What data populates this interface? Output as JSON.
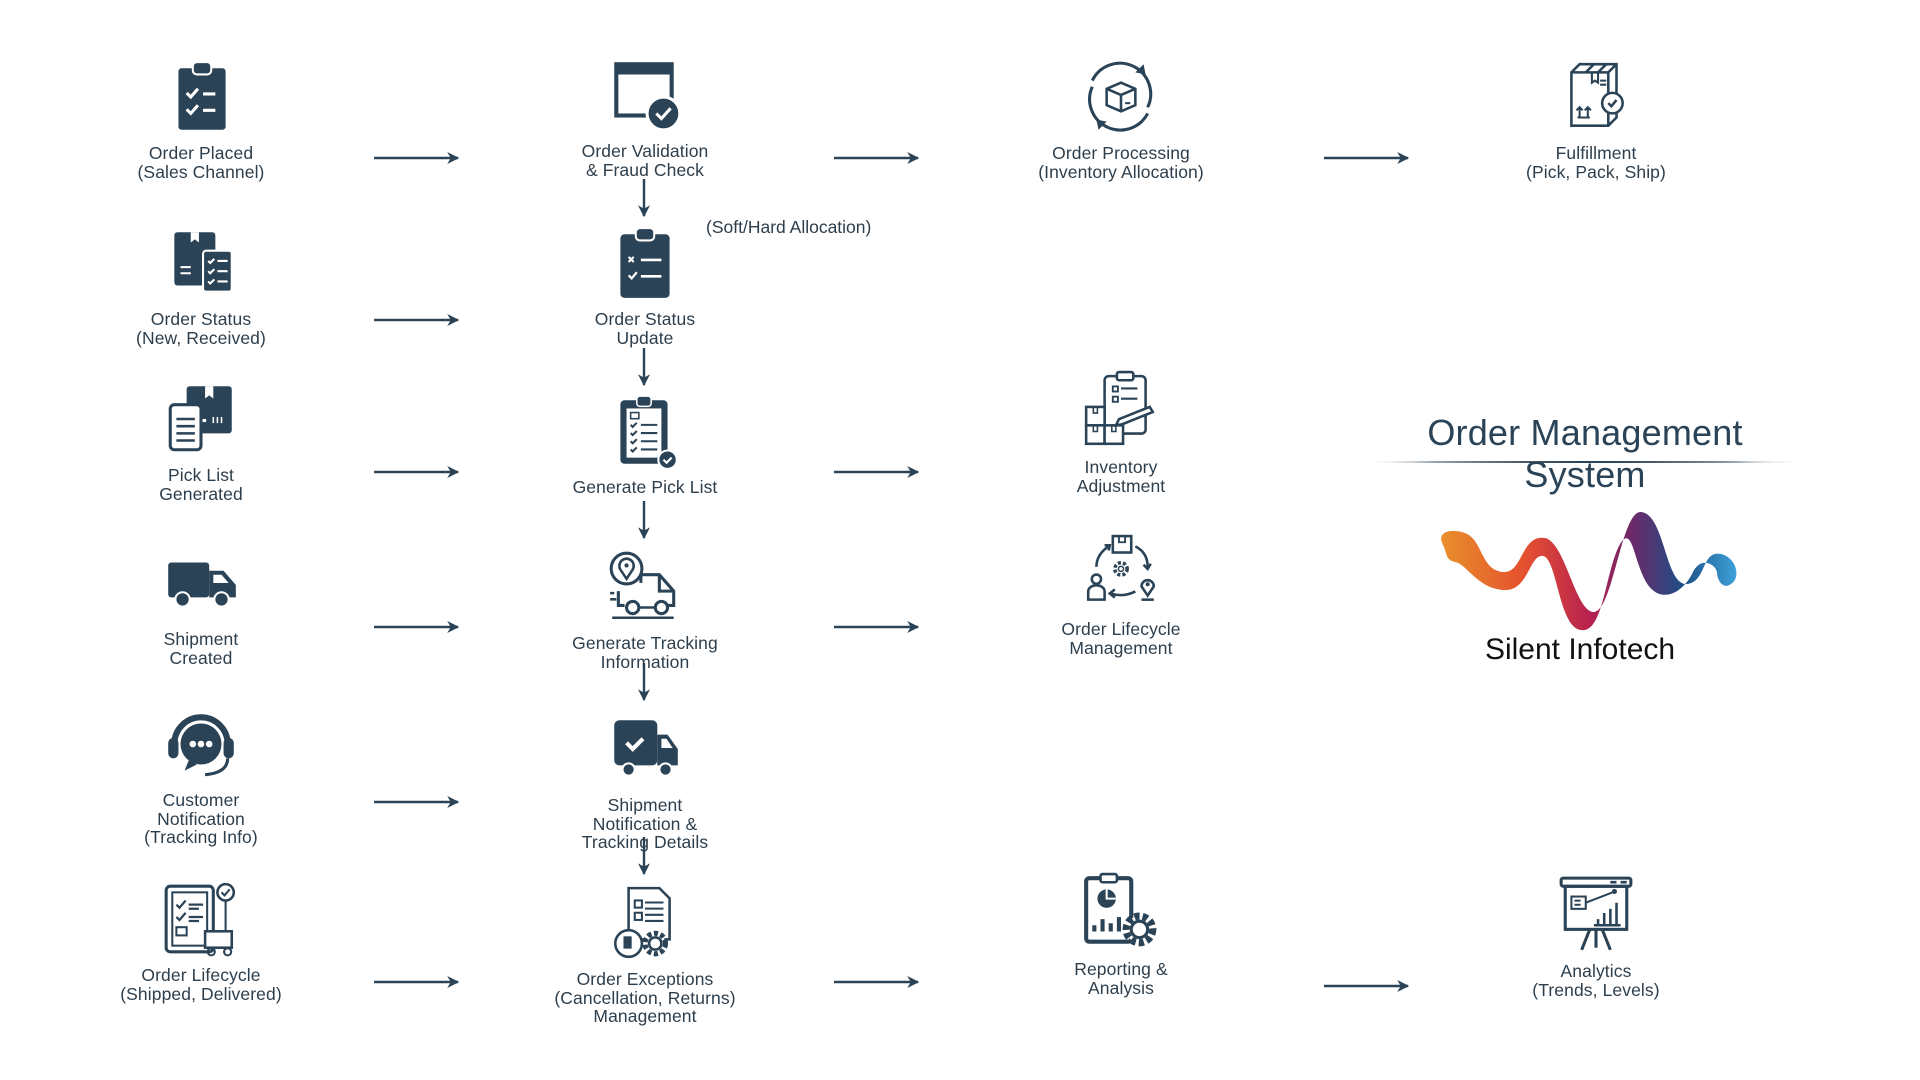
{
  "title": "Order Management System",
  "brand": {
    "name": "Silent Infotech",
    "gradient": [
      "#e8902a",
      "#e5512f",
      "#b8224f",
      "#6a2a6a",
      "#1d4f86",
      "#3ea3db"
    ]
  },
  "colors": {
    "ink": "#2b4356",
    "text": "#2d3e4c",
    "background": "#ffffff"
  },
  "annotation": "(Soft/Hard Allocation)",
  "nodes": {
    "order_placed": {
      "label": "Order  Placed\n(Sales Channel)",
      "icon": "clipboard-checklist-icon"
    },
    "order_status": {
      "label": "Order Status\n(New, Received)",
      "icon": "package-checklist-icon"
    },
    "pick_list_generated": {
      "label": "Pick List\nGenerated",
      "icon": "box-list-icon"
    },
    "shipment_created": {
      "label": "Shipment\nCreated",
      "icon": "delivery-truck-icon"
    },
    "customer_notification": {
      "label": "Customer\nNotification\n(Tracking Info)",
      "icon": "headset-chat-icon"
    },
    "order_lifecycle": {
      "label": "Order Lifecycle\n(Shipped, Delivered)",
      "icon": "clipboard-cart-icon"
    },
    "order_validation": {
      "label": "Order Validation\n& Fraud Check",
      "icon": "window-check-icon"
    },
    "order_status_update": {
      "label": "Order Status\nUpdate",
      "icon": "clipboard-list-icon"
    },
    "generate_pick_list": {
      "label": "Generate Pick List",
      "icon": "clipboard-check-icon"
    },
    "generate_tracking": {
      "label": "Generate Tracking\nInformation",
      "icon": "truck-location-icon"
    },
    "shipment_notification": {
      "label": "Shipment\nNotification &\nTracking Details",
      "icon": "truck-check-icon"
    },
    "order_exceptions": {
      "label": "Order Exceptions\n(Cancellation, Returns)\nManagement",
      "icon": "document-gear-icon"
    },
    "order_processing": {
      "label": "Order Processing\n(Inventory Allocation)",
      "icon": "box-cycle-icon"
    },
    "inventory_adjustment": {
      "label": "Inventory\nAdjustment",
      "icon": "inventory-clipboard-icon"
    },
    "order_lifecycle_management": {
      "label": "Order Lifecycle\nManagement",
      "icon": "lifecycle-cycle-icon"
    },
    "reporting_analysis": {
      "label": "Reporting &\nAnalysis",
      "icon": "report-gear-icon"
    },
    "fulfillment": {
      "label": "Fulfillment\n(Pick, Pack, Ship)",
      "icon": "package-check-icon"
    },
    "analytics": {
      "label": "Analytics\n(Trends, Levels)",
      "icon": "presentation-chart-icon"
    }
  }
}
